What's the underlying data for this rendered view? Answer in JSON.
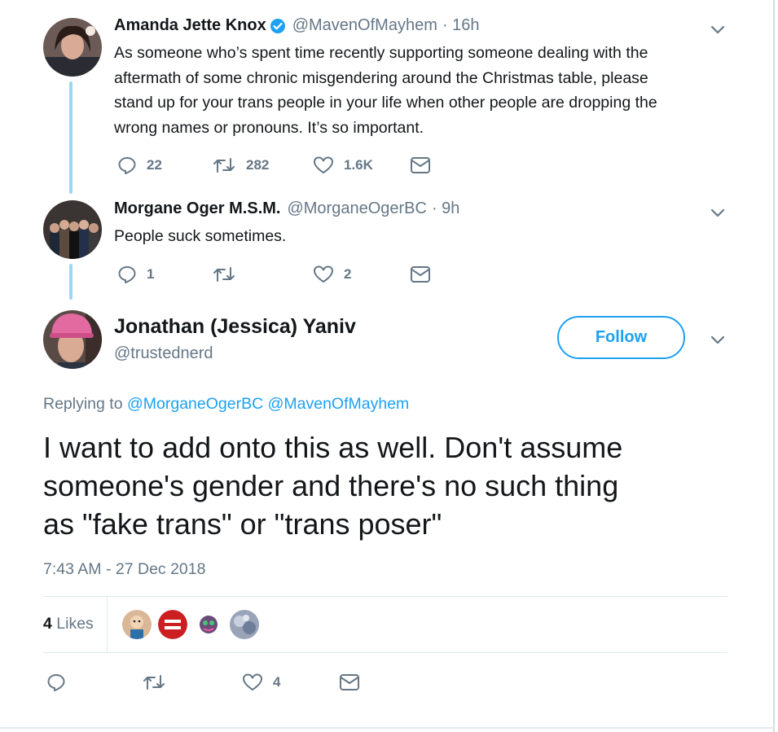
{
  "tweets": [
    {
      "name": "Amanda Jette Knox",
      "verified": true,
      "handle": "@MavenOfMayhem",
      "time": "· 16h",
      "text_lines": [
        "As someone who’s spent time recently supporting someone dealing with the",
        "aftermath of some chronic misgendering around the Christmas table, please",
        "stand up for your trans people in your life when other people are dropping the",
        "wrong names or pronouns. It’s so important."
      ],
      "replies": "22",
      "retweets": "282",
      "likes": "1.6K"
    },
    {
      "name": "Morgane Oger M.S.M.",
      "handle": "@MorganeOgerBC",
      "time": "· 9h",
      "text": "People suck sometimes.",
      "replies": "1",
      "retweets": "",
      "likes": "2"
    }
  ],
  "main": {
    "name": "Jonathan (Jessica) Yaniv",
    "handle": "@trustednerd",
    "follow_label": "Follow",
    "replying_prefix": "Replying to",
    "replying_to": [
      "@MorganeOgerBC",
      "@MavenOfMayhem"
    ],
    "text_lines": [
      "I want to add onto this as well. Don't assume",
      "someone's gender and there's no such thing",
      "as \"fake trans\" or \"trans poser\""
    ],
    "timestamp": "7:43 AM - 27 Dec 2018",
    "likes_count": "4",
    "likes_label": "Likes",
    "action_likes": "4"
  },
  "colors": {
    "accent": "#1da1f2",
    "thread_line": "#9bd6f5",
    "secondary_text": "#657786"
  }
}
